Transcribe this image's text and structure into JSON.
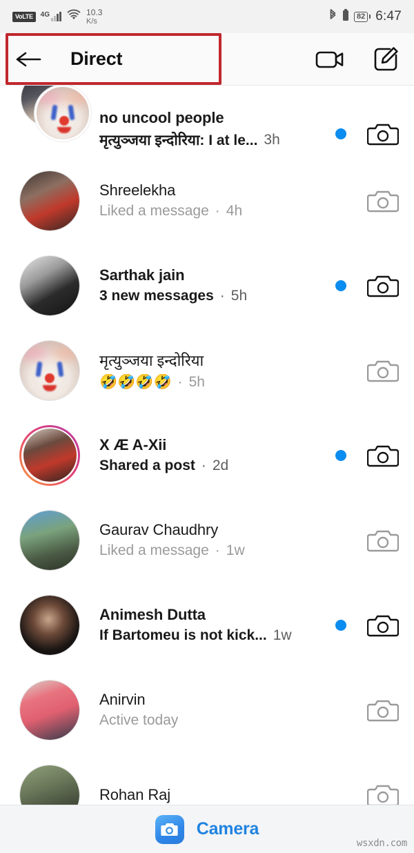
{
  "status_bar": {
    "volte": "VoLTE",
    "network": "4G",
    "data_rate_value": "10.3",
    "data_rate_unit": "K/s",
    "battery": "82",
    "time": "6:47",
    "icons": [
      "volte-badge",
      "signal-bars-icon",
      "wifi-icon",
      "bluetooth-icon",
      "battery-icon"
    ]
  },
  "header": {
    "title": "Direct",
    "back_icon": "back-arrow-icon",
    "video_icon": "video-camera-icon",
    "compose_icon": "compose-pencil-icon",
    "highlight_color": "#c0272d"
  },
  "theme": {
    "unread_dot_color": "#0a8cf0",
    "camera_active_color": "#111111",
    "camera_muted_color": "#9a9a9a",
    "camera_button_blue": "#1f83e0",
    "story_ring": "#e8466c"
  },
  "conversations": [
    {
      "name": "no uncool people",
      "preview": "मृत्युञ्जया इन्दोरिया: I at le...",
      "time": "3h",
      "separator": "",
      "unread": true,
      "avatar_type": "group",
      "story_ring": false,
      "camera_icon": "camera-icon"
    },
    {
      "name": "Shreelekha",
      "preview": "Liked a message",
      "time": "4h",
      "separator": "·",
      "unread": false,
      "avatar_type": "single",
      "story_ring": false,
      "camera_icon": "camera-icon"
    },
    {
      "name": "Sarthak jain",
      "preview": "3 new messages",
      "time": "5h",
      "separator": "·",
      "unread": true,
      "avatar_type": "single",
      "story_ring": false,
      "camera_icon": "camera-icon"
    },
    {
      "name": "मृत्युञ्जया इन्दोरिया",
      "preview": "🤣🤣🤣🤣",
      "time": "5h",
      "separator": "·",
      "unread": false,
      "avatar_type": "single",
      "story_ring": false,
      "camera_icon": "camera-icon"
    },
    {
      "name": "X Æ A-Xii",
      "preview": "Shared a post",
      "time": "2d",
      "separator": "·",
      "unread": true,
      "avatar_type": "single",
      "story_ring": true,
      "camera_icon": "camera-icon"
    },
    {
      "name": "Gaurav Chaudhry",
      "preview": "Liked a message",
      "time": "1w",
      "separator": "·",
      "unread": false,
      "avatar_type": "single",
      "story_ring": false,
      "camera_icon": "camera-icon"
    },
    {
      "name": "Animesh Dutta",
      "preview": "If Bartomeu is not kick...",
      "time": "1w",
      "separator": "",
      "unread": true,
      "avatar_type": "single",
      "story_ring": false,
      "camera_icon": "camera-icon"
    },
    {
      "name": "Anirvin",
      "preview": "Active today",
      "time": "",
      "separator": "",
      "unread": false,
      "avatar_type": "single",
      "story_ring": false,
      "camera_icon": "camera-icon"
    },
    {
      "name": "Rohan Raj",
      "preview": "",
      "time": "",
      "separator": "",
      "unread": false,
      "avatar_type": "single",
      "story_ring": false,
      "camera_icon": "camera-icon"
    }
  ],
  "bottom_bar": {
    "camera_label": "Camera",
    "camera_icon": "camera-icon"
  },
  "watermark": "wsxdn.com"
}
